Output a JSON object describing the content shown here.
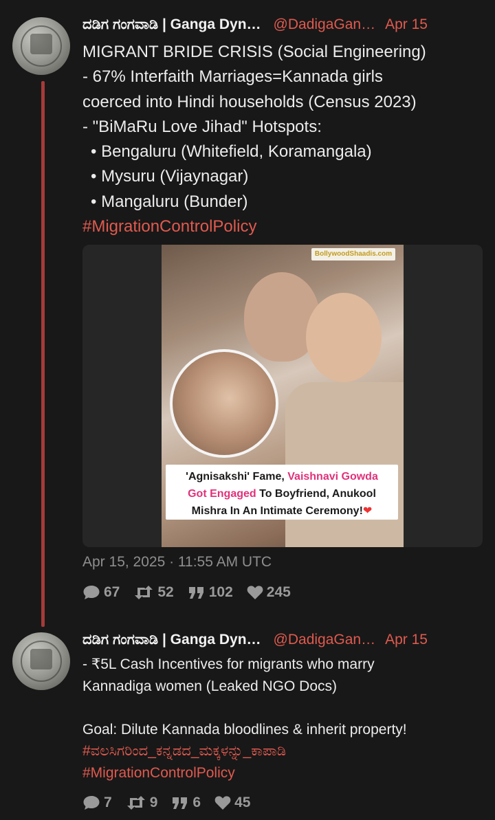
{
  "tweets": [
    {
      "name": "ದಡಿಗ ಗಂಗವಾಡಿ | Ganga Dyn…",
      "handle": "@DadigaGan…",
      "date": "Apr 15",
      "lines": [
        "MIGRANT BRIDE CRISIS (Social Engineering)",
        "- 67% Interfaith Marriages=Kannada girls",
        "coerced into Hindi households (Census 2023)",
        "- \"BiMaRu Love Jihad\" Hotspots:",
        "• Bengaluru (Whitefield, Koramangala)",
        "• Mysuru (Vijaynagar)",
        "• Mangaluru (Bunder)"
      ],
      "hashtags": [
        "#MigrationControlPolicy"
      ],
      "media": {
        "watermark": "BollywoodShaadis.com",
        "caption_part1": "'Agnisakshi' Fame, ",
        "caption_highlight1": "Vaishnavi Gowda",
        "caption_highlight2": "Got Engaged",
        "caption_part2": " To Boyfriend, Anukool",
        "caption_part3": "Mishra In An Intimate Ceremony!",
        "caption_emoji": "❤"
      },
      "timestamp": "Apr 15, 2025 · 11:55 AM UTC",
      "stats": {
        "replies": "67",
        "retweets": "52",
        "quotes": "102",
        "likes": "245"
      }
    },
    {
      "name": "ದಡಿಗ ಗಂಗವಾಡಿ | Ganga Dyn…",
      "handle": "@DadigaGan…",
      "date": "Apr 15",
      "lines": [
        "- ₹5L Cash Incentives for migrants who marry",
        "Kannadiga women (Leaked NGO Docs)",
        "",
        "Goal: Dilute Kannada bloodlines & inherit property!"
      ],
      "hashtags": [
        "#ವಲಸಿಗರಿಂದ_ಕನ್ನಡದ_ಮಕ್ಕಳನ್ನು_ಕಾಪಾಡಿ",
        "#MigrationControlPolicy"
      ],
      "stats": {
        "replies": "7",
        "retweets": "9",
        "quotes": "6",
        "likes": "45"
      }
    }
  ],
  "colors": {
    "accent": "#e05a4f",
    "thread_line": "#a63a3a",
    "background": "#181818"
  }
}
